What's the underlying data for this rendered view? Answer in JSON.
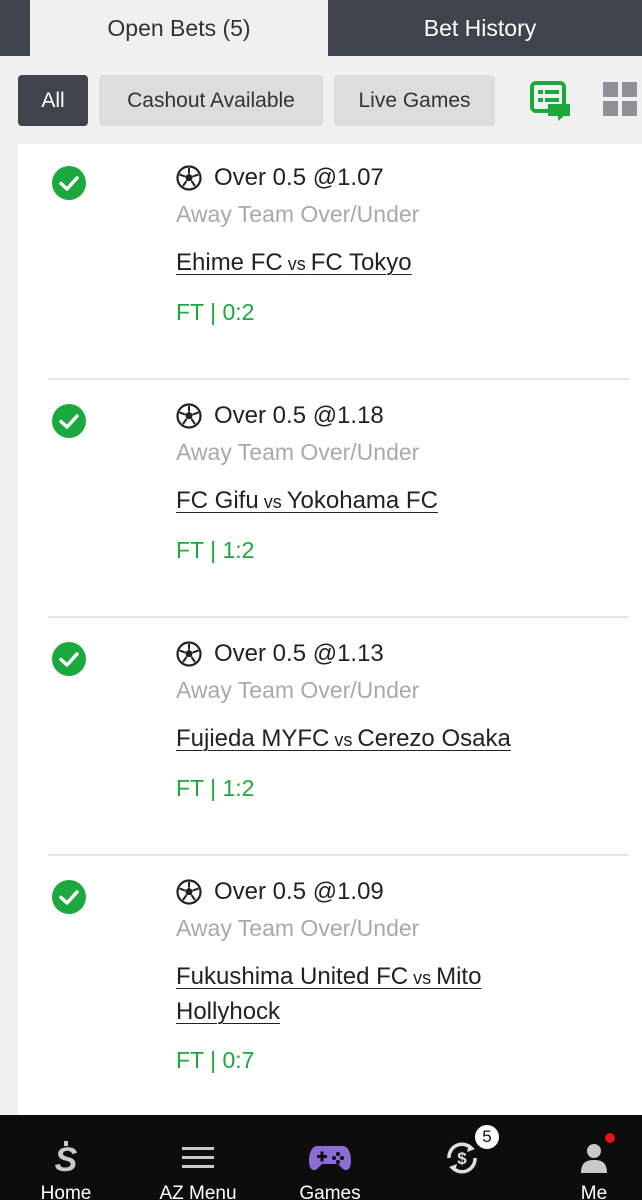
{
  "tabs": {
    "open_bets": "Open Bets (5)",
    "bet_history": "Bet History"
  },
  "filters": {
    "all": "All",
    "cashout": "Cashout Available",
    "live": "Live Games"
  },
  "bets": [
    {
      "selection": "Over 0.5 @1.07",
      "market": "Away Team Over/Under",
      "home": "Ehime FC",
      "vs": "vs",
      "away": "FC Tokyo",
      "result": "FT | 0:2",
      "status_icon": "check-circle-icon"
    },
    {
      "selection": "Over 0.5 @1.18",
      "market": "Away Team Over/Under",
      "home": "FC Gifu",
      "vs": "vs",
      "away": "Yokohama FC",
      "result": "FT | 1:2",
      "status_icon": "check-circle-icon"
    },
    {
      "selection": "Over 0.5 @1.13",
      "market": "Away Team Over/Under",
      "home": "Fujieda MYFC",
      "vs": "vs",
      "away": "Cerezo Osaka",
      "result": "FT | 1:2",
      "status_icon": "check-circle-icon"
    },
    {
      "selection": "Over 0.5 @1.09",
      "market": "Away Team Over/Under",
      "home": "Fukushima United FC",
      "vs": "vs",
      "away": "Mito Hollyhock",
      "result": "FT | 0:7",
      "status_icon": "check-circle-icon"
    }
  ],
  "nav": {
    "home": "Home",
    "az_menu": "AZ Menu",
    "games": "Games",
    "mybets_badge": "5",
    "me": "Me"
  },
  "colors": {
    "accent_green": "#1ba83c",
    "dark": "#3f434b",
    "games_purple": "#8b6cd6"
  }
}
